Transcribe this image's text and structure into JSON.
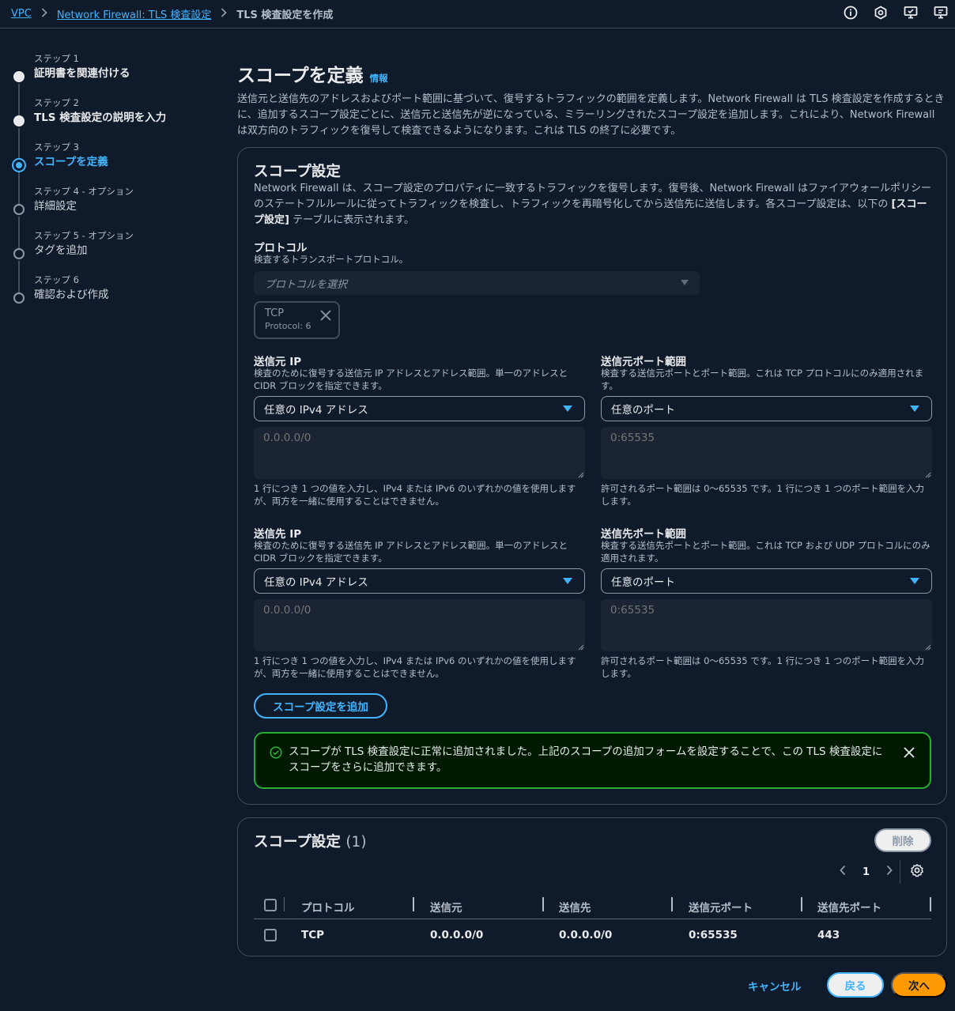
{
  "breadcrumb": {
    "items": [
      "VPC",
      "Network Firewall: TLS 検査設定"
    ],
    "current": "TLS 検査設定を作成"
  },
  "top_icons": [
    "info-icon",
    "settings-hex-icon",
    "feedback-icon",
    "screen-icon"
  ],
  "steps": [
    {
      "num": "ステップ 1",
      "label": "証明書を関連付ける",
      "state": "done"
    },
    {
      "num": "ステップ 2",
      "label": "TLS 検査設定の説明を入力",
      "state": "done"
    },
    {
      "num": "ステップ 3",
      "label": "スコープを定義",
      "state": "active"
    },
    {
      "num": "ステップ 4 - オプション",
      "label": "詳細設定",
      "state": "todo"
    },
    {
      "num": "ステップ 5 - オプション",
      "label": "タグを追加",
      "state": "todo"
    },
    {
      "num": "ステップ 6",
      "label": "確認および作成",
      "state": "todo"
    }
  ],
  "header": {
    "title": "スコープを定義",
    "info": "情報",
    "description": "送信元と送信先のアドレスおよびポート範囲に基づいて、復号するトラフィックの範囲を定義します。Network Firewall は TLS 検査設定を作成するときに、追加するスコープ設定ごとに、送信元と送信先が逆になっている、ミラーリングされたスコープ設定を追加します。これにより、Network Firewall は双方向のトラフィックを復号して検査できるようになります。これは TLS の終了に必要です。"
  },
  "scope_form": {
    "title": "スコープ設定",
    "description_before": "Network Firewall は、スコープ設定のプロパティに一致するトラフィックを復号します。復号後、Network Firewall はファイアウォールポリシーのステートフルルールに従ってトラフィックを検査し、トラフィックを再暗号化してから送信先に送信します。各スコープ設定は、以下の ",
    "description_bold": "[スコープ設定]",
    "description_after": " テーブルに表示されます。",
    "protocol": {
      "label": "プロトコル",
      "sublabel": "検査するトランスポートプロトコル。",
      "placeholder": "プロトコルを選択",
      "token_name": "TCP",
      "token_sub": "Protocol: 6"
    },
    "source_ip": {
      "label": "送信元 IP",
      "sublabel": "検査のために復号する送信元 IP アドレスとアドレス範囲。単一のアドレスと CIDR ブロックを指定できます。",
      "select_value": "任意の IPv4 アドレス",
      "placeholder": "0.0.0.0/0",
      "hint": "1 行につき 1 つの値を入力し、IPv4 または IPv6 のいずれかの値を使用しますが、両方を一緒に使用することはできません。"
    },
    "source_port": {
      "label": "送信元ポート範囲",
      "sublabel": "検査する送信元ポートとポート範囲。これは TCP プロトコルにのみ適用されます。",
      "select_value": "任意のポート",
      "placeholder": "0:65535",
      "hint": "許可されるポート範囲は 0～65535 です。1 行につき 1 つのポート範囲を入力します。"
    },
    "dest_ip": {
      "label": "送信先 IP",
      "sublabel": "検査のために復号する送信先 IP アドレスとアドレス範囲。単一のアドレスと CIDR ブロックを指定できます。",
      "select_value": "任意の IPv4 アドレス",
      "placeholder": "0.0.0.0/0",
      "hint": "1 行につき 1 つの値を入力し、IPv4 または IPv6 のいずれかの値を使用しますが、両方を一緒に使用することはできません。"
    },
    "dest_port": {
      "label": "送信先ポート範囲",
      "sublabel": "検査する送信先ポートとポート範囲。これは TCP および UDP プロトコルにのみ適用されます。",
      "select_value": "任意のポート",
      "placeholder": "0:65535",
      "hint": "許可されるポート範囲は 0～65535 です。1 行につき 1 つのポート範囲を入力します。"
    },
    "add_button": "スコープ設定を追加",
    "flash": "スコープが TLS 検査設定に正常に追加されました。上記のスコープの追加フォームを設定することで、この TLS 検査設定にスコープをさらに追加できます。"
  },
  "scope_table": {
    "title": "スコープ設定",
    "count": "(1)",
    "delete_button": "削除",
    "page": "1",
    "columns": [
      "プロトコル",
      "送信元",
      "送信先",
      "送信元ポート",
      "送信先ポート"
    ],
    "rows": [
      [
        "TCP",
        "0.0.0.0/0",
        "0.0.0.0/0",
        "0:65535",
        "443"
      ]
    ]
  },
  "footer": {
    "cancel": "キャンセル",
    "back": "戻る",
    "next": "次へ"
  },
  "colors": {
    "background": "#0f1b2a",
    "accent": "#42b4ff",
    "primary_button": "#ff9900",
    "success": "#29ad32"
  }
}
